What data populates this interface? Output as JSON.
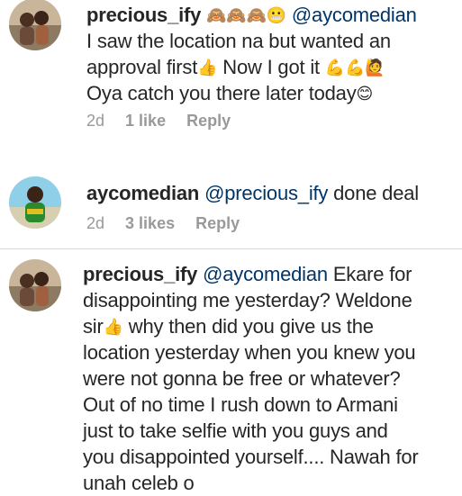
{
  "comments": [
    {
      "username": "precious_ify",
      "emojis_after_name": "🙈🙈🙈😬",
      "mention": "@aycomedian",
      "line1": "I saw the location na but wanted an",
      "line2_text": "approval first",
      "line2_emoji": "👍",
      "line2_rest": " Now I got it ",
      "line2_end_emoji": "💪💪🙋",
      "line3_text": "Oya catch you there later today",
      "line3_emoji": "😊",
      "time": "2d",
      "likes": "1 like",
      "reply": "Reply"
    },
    {
      "username": "aycomedian",
      "mention": "@precious_ify",
      "text": " done deal",
      "time": "2d",
      "likes": "3 likes",
      "reply": "Reply"
    },
    {
      "username": "precious_ify",
      "mention": "@aycomedian",
      "lines": [
        " Ekare for",
        "disappointing me yesterday? Weldone",
        "sir",
        " why then did you give us the",
        "location yesterday when you knew you",
        "were not gonna be free or whatever?",
        "Out of no time I rush down to Armani",
        "just to take selfie with you guys and",
        "you disappointed yourself.... Nawah for",
        "unah celeb o"
      ],
      "sir_emoji": "👍"
    }
  ],
  "colors": {
    "text": "#262626",
    "mention": "#003569",
    "meta": "#999999",
    "divider": "#dbdbdb"
  }
}
